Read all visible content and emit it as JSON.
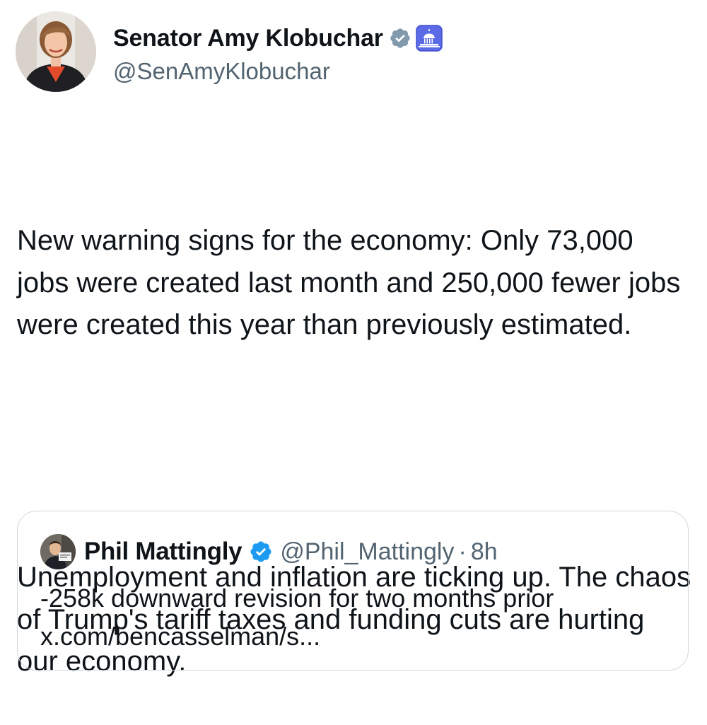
{
  "author": {
    "display_name": "Senator Amy Klobuchar",
    "handle": "@SenAmyKlobuchar",
    "badges": [
      "verified-gray-badge",
      "government-capitol-icon"
    ],
    "avatar": "profile-photo-amy-klobuchar"
  },
  "tweet": {
    "paragraphs": [
      "New warning signs for the economy: Only 73,000 jobs were created last month and 250,000 fewer jobs were created this year than previously estimated.",
      "Unemployment and inflation are ticking up. The chaos of Trump's tariff taxes and funding cuts are hurting our economy."
    ]
  },
  "quote": {
    "display_name": "Phil Mattingly",
    "handle": "@Phil_Mattingly",
    "separator": "·",
    "time": "8h",
    "badge": "verified-blue-badge",
    "avatar": "profile-photo-phil-mattingly",
    "text_lines": [
      "-258k downward revision for two months prior",
      "x.com/bencasselman/s..."
    ]
  },
  "colors": {
    "text_primary": "#0f1419",
    "text_secondary": "#536471",
    "verified_blue": "#1d9bf0",
    "verified_gray": "#829aab",
    "gov_badge_bg": "#5b6be6",
    "border": "#cfd9de"
  }
}
